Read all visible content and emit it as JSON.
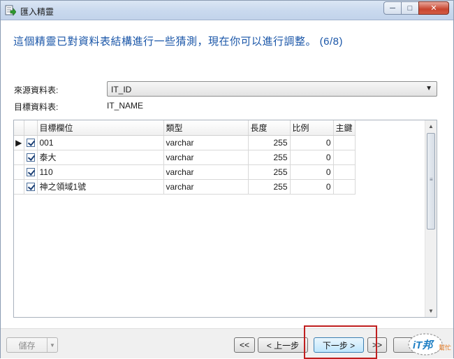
{
  "window": {
    "title": "匯入精靈",
    "controls": {
      "minimize": "─",
      "maximize": "□",
      "close": "✕"
    }
  },
  "heading": "這個精靈已對資料表結構進行一些猜測，現在你可以進行調整。 (6/8)",
  "source": {
    "label": "來源資料表:",
    "value": "IT_ID"
  },
  "target": {
    "label": "目標資料表:",
    "value": "IT_NAME"
  },
  "grid": {
    "columns": [
      "目標欄位",
      "類型",
      "長度",
      "比例",
      "主鍵"
    ],
    "rows": [
      {
        "checked": true,
        "current": true,
        "name": "001",
        "type": "varchar",
        "length": "255",
        "scale": "0"
      },
      {
        "checked": true,
        "current": false,
        "name": "泰大",
        "type": "varchar",
        "length": "255",
        "scale": "0"
      },
      {
        "checked": true,
        "current": false,
        "name": "110",
        "type": "varchar",
        "length": "255",
        "scale": "0"
      },
      {
        "checked": true,
        "current": false,
        "name": "神之領域1號",
        "type": "varchar",
        "length": "255",
        "scale": "0"
      }
    ]
  },
  "footer": {
    "save_label": "儲存",
    "first_label": "<<",
    "prev_label": "< 上一步",
    "next_label": "下一步 >",
    "last_label": ">>"
  },
  "watermark": {
    "text": "iT邦",
    "sub": "幫忙"
  },
  "colors": {
    "heading": "#1a56a8",
    "highlight": "#c01f1f",
    "close_button": "#c8452f"
  }
}
